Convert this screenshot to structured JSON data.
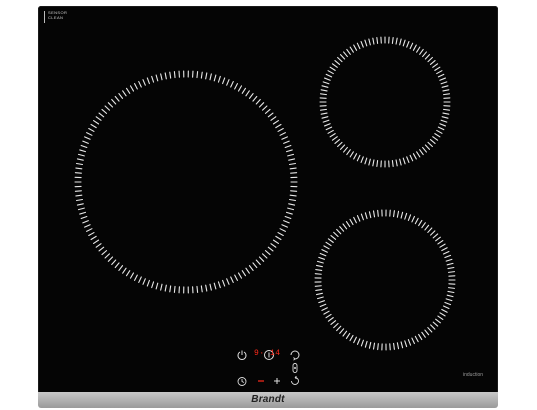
{
  "badge": {
    "line1": "SENSOR",
    "line2": "CLEAN"
  },
  "controls": {
    "display_left": "9",
    "display_right": "14",
    "icons": [
      "power-icon",
      "lock-icon",
      "boost-icon",
      "timer-icon",
      "minus-icon",
      "plus-icon",
      "zone-select-icon",
      "pause-icon"
    ]
  },
  "labels": {
    "induction": "induction",
    "brand": "Brandt"
  },
  "colors": {
    "glass": "#050505",
    "ring": "#e8e8e8",
    "display": "#ff2a1a",
    "frame": "#b0b0b0"
  }
}
